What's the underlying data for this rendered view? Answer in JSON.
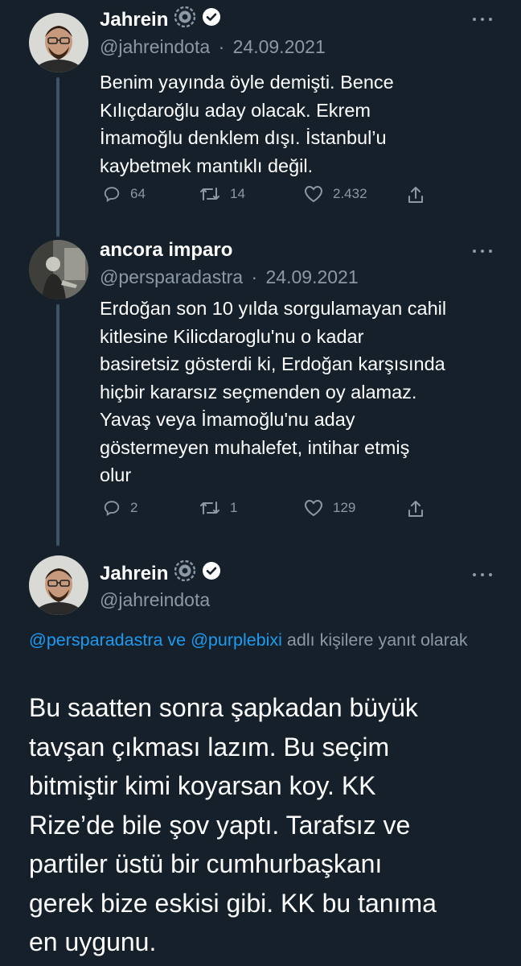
{
  "tweets": [
    {
      "name": "Jahrein",
      "handle": "@jahreindota",
      "date": "24.09.2021",
      "separator": "·",
      "text": "Benim yayında öyle demişti. Bence\nKılıçdaroğlu aday olacak. Ekrem\nİmamoğlu denklem dışı. İstanbul’u\nkaybetmek mantıklı değil.",
      "replies": "64",
      "retweets": "14",
      "likes": "2.432"
    },
    {
      "name": "ancora imparo",
      "handle": "@persparadastra",
      "date": "24.09.2021",
      "separator": "·",
      "text": "Erdoğan son 10 yılda sorgulamayan cahil\nkitlesine Kilicdaroglu'nu o kadar\nbasiretsiz gösterdi ki, Erdoğan karşısında\nhiçbir kararsız seçmenden oy alamaz.\nYavaş veya İmamoğlu'nu aday\ngöstermeyen muhalefet, intihar etmiş\nolur",
      "replies": "2",
      "retweets": "1",
      "likes": "129"
    }
  ],
  "main_tweet": {
    "name": "Jahrein",
    "handle": "@jahreindota",
    "reply_mention_1": "@persparadastra",
    "reply_connector": " ve ",
    "reply_mention_2": "@purplebixi",
    "reply_suffix": " adlı kişilere yanıt olarak",
    "text": "Bu saatten sonra şapkadan büyük\ntavşan çıkması lazım. Bu seçim\nbitmiştir kimi koyarsan koy. KK\nRize’de bile şov yaptı. Tarafsız ve\npartiler üstü bir cumhurbaşkanı\ngerek bize eskisi gibi. KK bu tanıma\nen uygunu."
  },
  "colors": {
    "background": "#15202b",
    "text": "#ffffff",
    "secondary": "#8b98a5",
    "accent": "#1d9bf0",
    "thread_line": "#3d5466"
  },
  "icons": [
    "settings-badge-icon",
    "verified-badge-icon",
    "more-icon",
    "reply-icon",
    "retweet-icon",
    "like-icon",
    "share-icon"
  ]
}
